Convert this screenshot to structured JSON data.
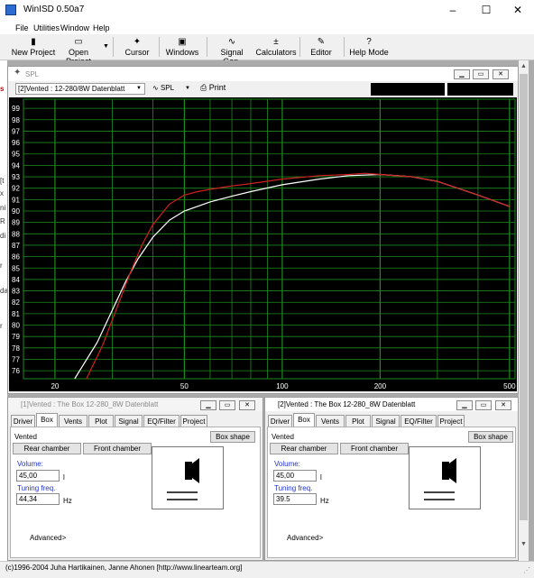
{
  "app": {
    "title": "WinISD 0.50a7"
  },
  "window_controls": {
    "minimize": "–",
    "maximize": "☐",
    "close": "✕"
  },
  "menu": [
    "File",
    "Utilities",
    "Window",
    "Help"
  ],
  "toolbar": [
    {
      "label": "New Project",
      "icon": "new-project-icon",
      "glyph": "▮"
    },
    {
      "label": "Open Project",
      "icon": "open-project-icon",
      "glyph": "▭"
    },
    {
      "label": "Cursor",
      "icon": "cursor-icon",
      "glyph": "✦"
    },
    {
      "label": "Windows",
      "icon": "windows-icon",
      "glyph": "▣"
    },
    {
      "label": "Signal Gen.",
      "icon": "signal-gen-icon",
      "glyph": "∿"
    },
    {
      "label": "Calculators",
      "icon": "calculators-icon",
      "glyph": "±"
    },
    {
      "label": "Editor",
      "icon": "editor-icon",
      "glyph": "✎"
    },
    {
      "label": "Help Mode",
      "icon": "help-icon",
      "glyph": "?"
    }
  ],
  "left_strip_chars": [
    "s",
    "[t",
    "x",
    "ni",
    "R",
    "di",
    "r",
    "da",
    "r"
  ],
  "spl": {
    "title": "SPL",
    "project_select": "[2]Vented : 12-280/8W Datenblatt",
    "graph_select": "SPL",
    "print_label": "Print"
  },
  "chart_data": {
    "type": "line",
    "x_scale": "log",
    "xlim": [
      16,
      520
    ],
    "ylim": [
      75.3,
      99.8
    ],
    "x_ticks": [
      20,
      50,
      100,
      200,
      500
    ],
    "y_ticks": [
      76,
      77,
      78,
      79,
      80,
      81,
      82,
      83,
      84,
      85,
      86,
      87,
      88,
      89,
      90,
      91,
      92,
      93,
      94,
      95,
      96,
      97,
      98,
      99
    ],
    "grid": true,
    "background": "#000000",
    "grid_color": "#1e8c1e",
    "series": [
      {
        "color": "#ffffff",
        "x": [
          23,
          27,
          30,
          33,
          36,
          40,
          45,
          50,
          60,
          70,
          80,
          100,
          130,
          160,
          200,
          250,
          300,
          400,
          500
        ],
        "y": [
          75.3,
          78.5,
          81.3,
          83.8,
          85.8,
          87.7,
          89.2,
          90.0,
          90.8,
          91.3,
          91.7,
          92.3,
          92.8,
          93.1,
          93.2,
          93.0,
          92.6,
          91.4,
          90.4
        ]
      },
      {
        "color": "#d02020",
        "x": [
          25,
          28,
          31,
          34,
          37,
          40,
          45,
          50,
          55,
          60,
          70,
          80,
          100,
          130,
          160,
          180,
          200,
          250,
          300,
          400,
          500
        ],
        "y": [
          75.3,
          78.2,
          81.5,
          84.5,
          87.0,
          88.8,
          90.6,
          91.4,
          91.7,
          91.9,
          92.2,
          92.4,
          92.8,
          93.1,
          93.2,
          93.3,
          93.2,
          93.0,
          92.6,
          91.4,
          90.4
        ]
      }
    ]
  },
  "panes": [
    {
      "title": "[1]Vented : The Box 12-280_8W Datenblatt",
      "title_color": "#8a8a8a",
      "tabs": [
        "Driver",
        "Box",
        "Vents",
        "Plot",
        "Signal",
        "EQ/Filter",
        "Project"
      ],
      "active_tab": "Box",
      "box_type": "Vented",
      "box_shape_label": "Box shape",
      "rear_chamber": "Rear chamber",
      "front_chamber": "Front chamber",
      "volume_label": "Volume:",
      "volume_value": "45,00",
      "volume_unit": "l",
      "tuning_label": "Tuning freq.",
      "tuning_value": "44,34",
      "tuning_unit": "Hz",
      "advanced": "Advanced>"
    },
    {
      "title": "[2]Vented : The Box 12-280_8W Datenblatt",
      "title_color": "#000000",
      "tabs": [
        "Driver",
        "Box",
        "Vents",
        "Plot",
        "Signal",
        "EQ/Filter",
        "Project"
      ],
      "active_tab": "Box",
      "box_type": "Vented",
      "box_shape_label": "Box shape",
      "rear_chamber": "Rear chamber",
      "front_chamber": "Front chamber",
      "volume_label": "Volume:",
      "volume_value": "45,00",
      "volume_unit": "l",
      "tuning_label": "Tuning freq.",
      "tuning_value": "39.5",
      "tuning_unit": "Hz",
      "advanced": "Advanced>"
    }
  ],
  "status": "(c)1996-2004 Juha Hartikainen, Janne Ahonen [http://www.linearteam.org]"
}
